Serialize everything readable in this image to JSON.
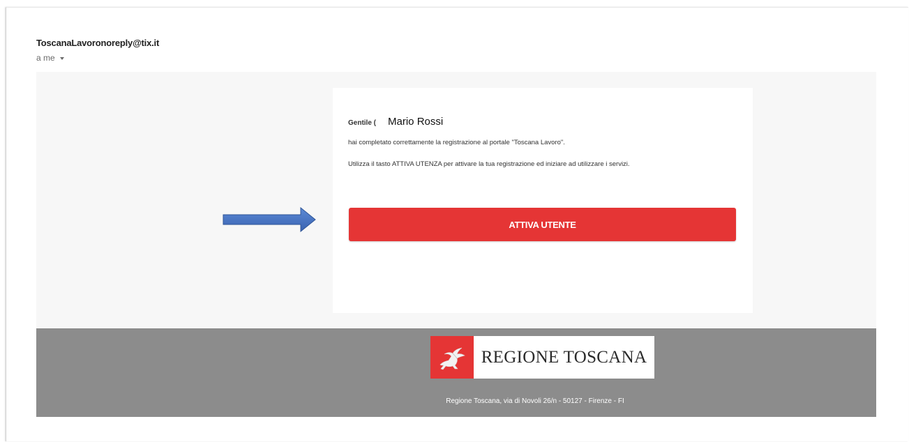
{
  "email": {
    "sender": "ToscanaLavoronoreply@tix.it",
    "recipient": "a me"
  },
  "message": {
    "greeting_label": "Gentile (",
    "recipient_name": "Mario Rossi",
    "line1": "hai completato correttamente la registrazione al portale \"Toscana Lavoro\".",
    "line2": "Utilizza il tasto ATTIVA UTENZA per attivare la tua registrazione ed iniziare ad utilizzare i servizi.",
    "cta_label": "ATTIVA UTENTE"
  },
  "footer": {
    "logo_text": "REGIONE TOSCANA",
    "address": "Regione Toscana, via di Novoli 26/n - 50127 - Firenze - FI"
  },
  "colors": {
    "accent_red": "#e53535",
    "arrow_blue": "#4472c4",
    "footer_gray": "#8c8c8c",
    "body_bg": "#f7f7f7"
  },
  "icons": {
    "caret": "chevron-down-icon",
    "arrow": "arrow-right-icon",
    "logo_mark": "pegasus-icon"
  }
}
